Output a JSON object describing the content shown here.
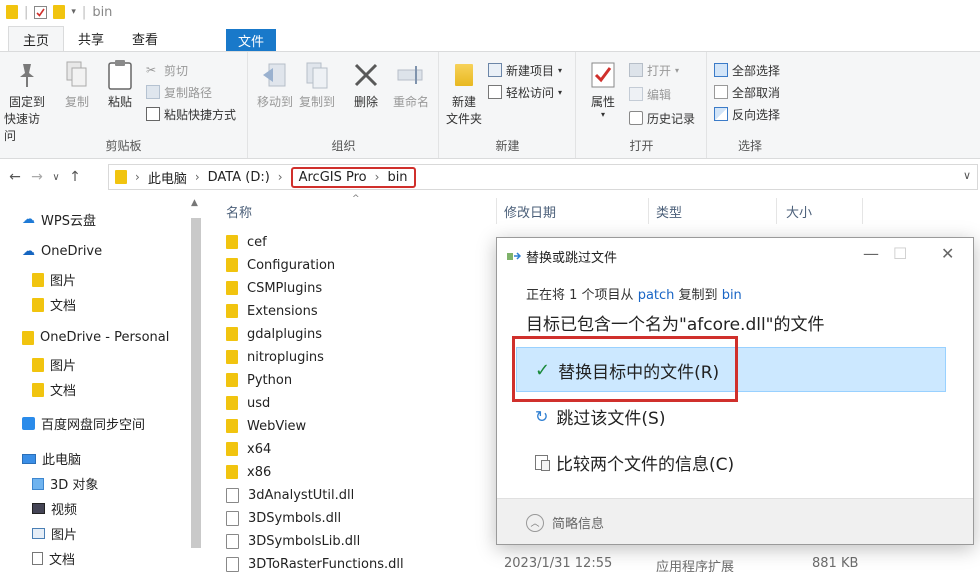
{
  "window": {
    "title": "bin"
  },
  "ribbon_tabs": [
    "文件",
    "主页",
    "共享",
    "查看"
  ],
  "ribbon": {
    "clipboard": {
      "group_label": "剪贴板",
      "pin_label_1": "固定到",
      "pin_label_2": "快速访问",
      "copy": "复制",
      "paste": "粘贴",
      "cut": "剪切",
      "copy_path": "复制路径",
      "paste_shortcut": "粘贴快捷方式"
    },
    "organize": {
      "group_label": "组织",
      "move_to": "移动到",
      "copy_to": "复制到",
      "delete": "删除",
      "rename": "重命名"
    },
    "new": {
      "group_label": "新建",
      "new_folder_1": "新建",
      "new_folder_2": "文件夹",
      "new_item": "新建项目",
      "easy_access": "轻松访问"
    },
    "open": {
      "group_label": "打开",
      "properties": "属性",
      "open": "打开",
      "edit": "编辑",
      "history": "历史记录"
    },
    "select": {
      "group_label": "选择",
      "select_all": "全部选择",
      "select_none": "全部取消",
      "invert": "反向选择"
    }
  },
  "address": {
    "crumbs": [
      "此电脑",
      "DATA (D:)",
      "ArcGIS Pro",
      "bin"
    ]
  },
  "sidebar": {
    "items": [
      {
        "label": "WPS云盘",
        "icon": "cloud-icon"
      },
      {
        "label": "OneDrive",
        "icon": "cloud-icon"
      },
      {
        "label": "图片",
        "icon": "folder-icon"
      },
      {
        "label": "文档",
        "icon": "folder-icon"
      },
      {
        "label": "OneDrive - Personal",
        "icon": "folder-icon"
      },
      {
        "label": "图片",
        "icon": "folder-icon"
      },
      {
        "label": "文档",
        "icon": "folder-icon"
      },
      {
        "label": "百度网盘同步空间",
        "icon": "cloud-sync-icon"
      },
      {
        "label": "此电脑",
        "icon": "computer-icon"
      },
      {
        "label": "3D 对象",
        "icon": "cube-icon"
      },
      {
        "label": "视频",
        "icon": "video-icon"
      },
      {
        "label": "图片",
        "icon": "picture-icon"
      },
      {
        "label": "文档",
        "icon": "document-icon"
      }
    ]
  },
  "columns": {
    "name": "名称",
    "date": "修改日期",
    "type": "类型",
    "size": "大小"
  },
  "files": [
    {
      "name": "cef",
      "kind": "folder"
    },
    {
      "name": "Configuration",
      "kind": "folder"
    },
    {
      "name": "CSMPlugins",
      "kind": "folder"
    },
    {
      "name": "Extensions",
      "kind": "folder"
    },
    {
      "name": "gdalplugins",
      "kind": "folder"
    },
    {
      "name": "nitroplugins",
      "kind": "folder"
    },
    {
      "name": "Python",
      "kind": "folder"
    },
    {
      "name": "usd",
      "kind": "folder"
    },
    {
      "name": "WebView",
      "kind": "folder"
    },
    {
      "name": "x64",
      "kind": "folder"
    },
    {
      "name": "x86",
      "kind": "folder"
    },
    {
      "name": "3dAnalystUtil.dll",
      "kind": "file"
    },
    {
      "name": "3DSymbols.dll",
      "kind": "file"
    },
    {
      "name": "3DSymbolsLib.dll",
      "kind": "file"
    },
    {
      "name": "3DToRasterFunctions.dll",
      "kind": "file"
    }
  ],
  "last_row_meta": {
    "date": "2023/1/31 12:55",
    "type": "应用程序扩展",
    "size": "881 KB"
  },
  "dialog": {
    "title": "替换或跳过文件",
    "info_prefix": "正在将 1 个项目从",
    "info_source": "patch",
    "info_mid": "复制到",
    "info_dest": "bin",
    "heading": "目标已包含一个名为\"afcore.dll\"的文件",
    "option_replace": "替换目标中的文件(R)",
    "option_skip": "跳过该文件(S)",
    "option_compare": "比较两个文件的信息(C)",
    "details": "简略信息"
  },
  "colors": {
    "accent": "#1979ca",
    "highlight": "#d0302c",
    "selection": "#cce8ff",
    "link": "#1a66c6"
  }
}
